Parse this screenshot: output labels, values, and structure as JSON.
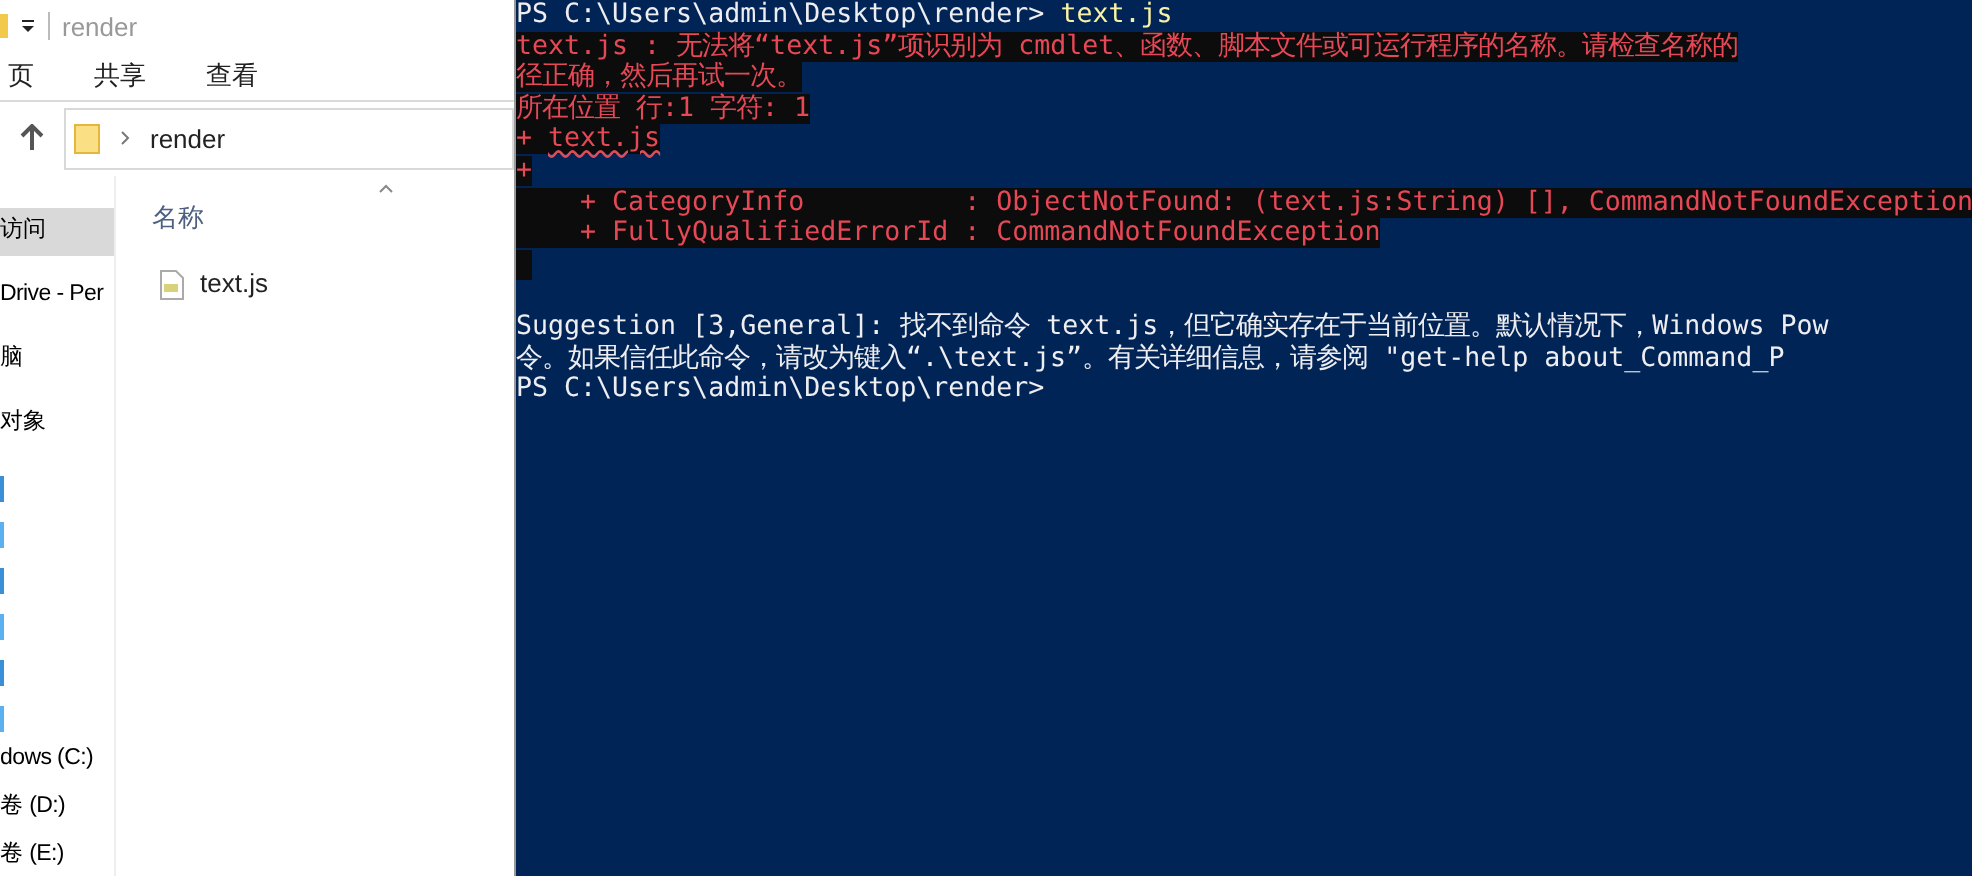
{
  "explorer": {
    "title": "render",
    "ribbon_tabs": [
      {
        "label": "页"
      },
      {
        "label": "共享"
      },
      {
        "label": "查看"
      }
    ],
    "address": {
      "crumbs": [
        "render"
      ]
    },
    "sidebar": {
      "items": [
        {
          "label": "访问",
          "selected": true
        },
        {
          "label": "Drive - Per",
          "selected": false
        },
        {
          "label": "脑",
          "selected": false
        },
        {
          "label": "对象",
          "selected": false
        },
        {
          "label": "dows (C:)",
          "selected": false
        },
        {
          "label": "卷 (D:)",
          "selected": false
        },
        {
          "label": "卷 (E:)",
          "selected": false
        }
      ]
    },
    "columns": [
      {
        "label": "名称"
      }
    ],
    "files": [
      {
        "name": "text.js"
      }
    ]
  },
  "terminal": {
    "lines": [
      {
        "kind": "prompt",
        "text": "PS C:\\Users\\admin\\Desktop\\render>",
        "command": "text.js"
      },
      {
        "kind": "error",
        "text": "text.js : 无法将“text.js”项识别为 cmdlet、函数、脚本文件或可运行程序的名称。请检查名称的"
      },
      {
        "kind": "error",
        "text": "径正确，然后再试一次。"
      },
      {
        "kind": "error",
        "text": "所在位置 行:1 字符: 1"
      },
      {
        "kind": "error_source",
        "text": "+ ",
        "source": "text.js"
      },
      {
        "kind": "error",
        "text": "+"
      },
      {
        "kind": "error",
        "text": "    + CategoryInfo          : ObjectNotFound: (text.js:String) [], CommandNotFoundException"
      },
      {
        "kind": "error",
        "text": "    + FullyQualifiedErrorId : CommandNotFoundException"
      },
      {
        "kind": "error_blank"
      },
      {
        "kind": "blank"
      },
      {
        "kind": "output",
        "text": "Suggestion [3,General]: 找不到命令 text.js，但它确实存在于当前位置。默认情况下，Windows Pow"
      },
      {
        "kind": "output",
        "text": "令。如果信任此命令，请改为键入“.\\text.js”。有关详细信息，请参阅 \"get-help about_Command_P"
      },
      {
        "kind": "output",
        "text": "PS C:\\Users\\admin\\Desktop\\render>"
      }
    ]
  }
}
